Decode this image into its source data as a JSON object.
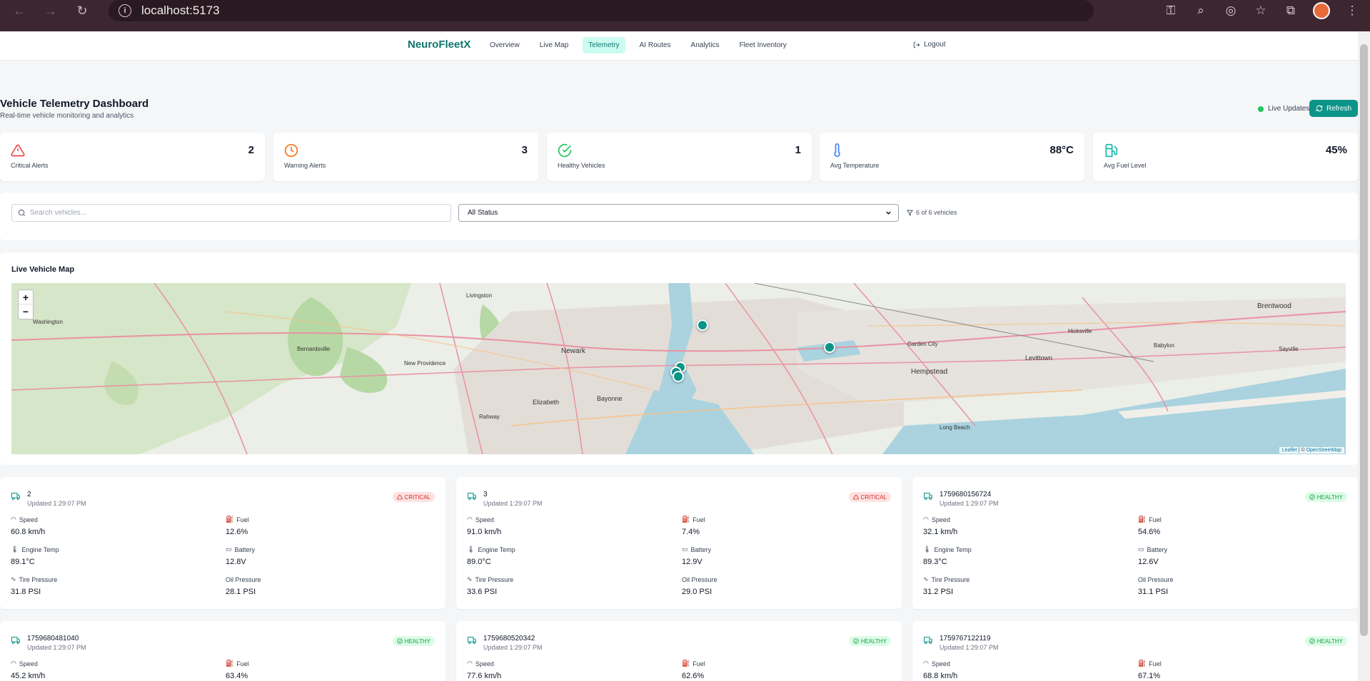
{
  "browser": {
    "url": "localhost:5173"
  },
  "header": {
    "brand": "NeuroFleetX",
    "nav": [
      "Overview",
      "Live Map",
      "Telemetry",
      "AI Routes",
      "Analytics",
      "Fleet Inventory"
    ],
    "active": "Telemetry",
    "logout": "Logout"
  },
  "page": {
    "title": "Vehicle Telemetry Dashboard",
    "subtitle": "Real-time vehicle monitoring and analytics",
    "live_label": "Live Updates",
    "refresh_label": "Refresh"
  },
  "stats": [
    {
      "label": "Critical Alerts",
      "value": "2",
      "color": "#ef4444"
    },
    {
      "label": "Warning Alerts",
      "value": "3",
      "color": "#f97316"
    },
    {
      "label": "Healthy Vehicles",
      "value": "1",
      "color": "#22c55e"
    },
    {
      "label": "Avg Temperature",
      "value": "88°C",
      "color": "#3b82f6"
    },
    {
      "label": "Avg Fuel Level",
      "value": "45%",
      "color": "#14b8a6"
    }
  ],
  "filter": {
    "search_placeholder": "Search vehicles...",
    "status_value": "All Status",
    "count": "6 of 6 vehicles"
  },
  "map": {
    "title": "Live Vehicle Map",
    "zoom_in": "+",
    "zoom_out": "−",
    "attribution_leaflet": "Leaflet",
    "attribution_sep": " | © ",
    "attribution_osm": "OpenStreetMap",
    "place_labels": [
      "Newark",
      "Hempstead",
      "Levittown",
      "Elizabeth",
      "Bayonne",
      "Brentwood",
      "Washington",
      "Bernardsville",
      "Garden City",
      "New Providence",
      "Livingston",
      "Rahway",
      "Long Beach",
      "Hicksville",
      "Babylon",
      "Sayville"
    ]
  },
  "metric_labels": {
    "speed": "Speed",
    "fuel": "Fuel",
    "temp": "Engine Temp",
    "battery": "Battery",
    "tire": "Tire Pressure",
    "oil": "Oil Pressure"
  },
  "vehicles": [
    {
      "id": "2",
      "updated": "Updated 1:29:07 PM",
      "status": "CRITICAL",
      "speed": "60.8 km/h",
      "fuel": "12.6%",
      "temp": "89.1°C",
      "battery": "12.8V",
      "tire": "31.8 PSI",
      "oil": "28.1 PSI"
    },
    {
      "id": "3",
      "updated": "Updated 1:29:07 PM",
      "status": "CRITICAL",
      "speed": "91.0 km/h",
      "fuel": "7.4%",
      "temp": "89.0°C",
      "battery": "12.9V",
      "tire": "33.6 PSI",
      "oil": "29.0 PSI"
    },
    {
      "id": "1759680156724",
      "updated": "Updated 1:29:07 PM",
      "status": "HEALTHY",
      "speed": "32.1 km/h",
      "fuel": "54.6%",
      "temp": "89.3°C",
      "battery": "12.6V",
      "tire": "31.2 PSI",
      "oil": "31.1 PSI"
    },
    {
      "id": "1759680481040",
      "updated": "Updated 1:29:07 PM",
      "status": "HEALTHY",
      "speed": "45.2 km/h",
      "fuel": "63.4%"
    },
    {
      "id": "1759680520342",
      "updated": "Updated 1:29:07 PM",
      "status": "HEALTHY",
      "speed": "77.6 km/h",
      "fuel": "62.6%"
    },
    {
      "id": "1759767122119",
      "updated": "Updated 1:29:07 PM",
      "status": "HEALTHY",
      "speed": "68.8 km/h",
      "fuel": "67.1%"
    }
  ]
}
